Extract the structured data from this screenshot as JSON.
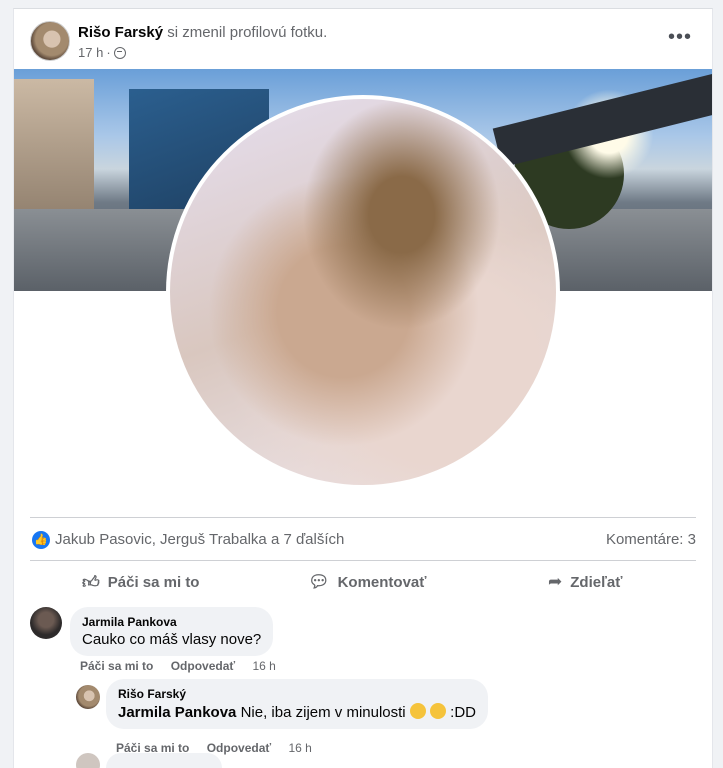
{
  "post": {
    "author": "Rišo Farský",
    "activity": "si zmenil profilovú fotku.",
    "time": "17 h",
    "separator": "·",
    "privacy_icon": "globe-icon",
    "more_icon": "more-options-icon"
  },
  "reactions": {
    "icon": "like-icon",
    "likers": "Jakub Pasovic, Jerguš Trabalka a 7 ďalších",
    "comments_count": "Komentáre: 3"
  },
  "actions": {
    "like": "Páči sa mi to",
    "comment": "Komentovať",
    "share": "Zdieľať"
  },
  "comments": [
    {
      "name": "Jarmila Pankova",
      "text": "Cauko co máš vlasy nove?",
      "like": "Páči sa mi to",
      "reply": "Odpovedať",
      "time": "16 h"
    },
    {
      "name": "Rišo Farský",
      "tag": "Jarmila Pankova",
      "text": "Nie, iba zijem v minulosti",
      "suffix": ":DD",
      "like": "Páči sa mi to",
      "reply": "Odpovedať",
      "time": "16 h"
    }
  ],
  "colors": {
    "accent": "#1877f2",
    "muted_text": "#65676b",
    "bubble_bg": "#f0f2f5"
  }
}
